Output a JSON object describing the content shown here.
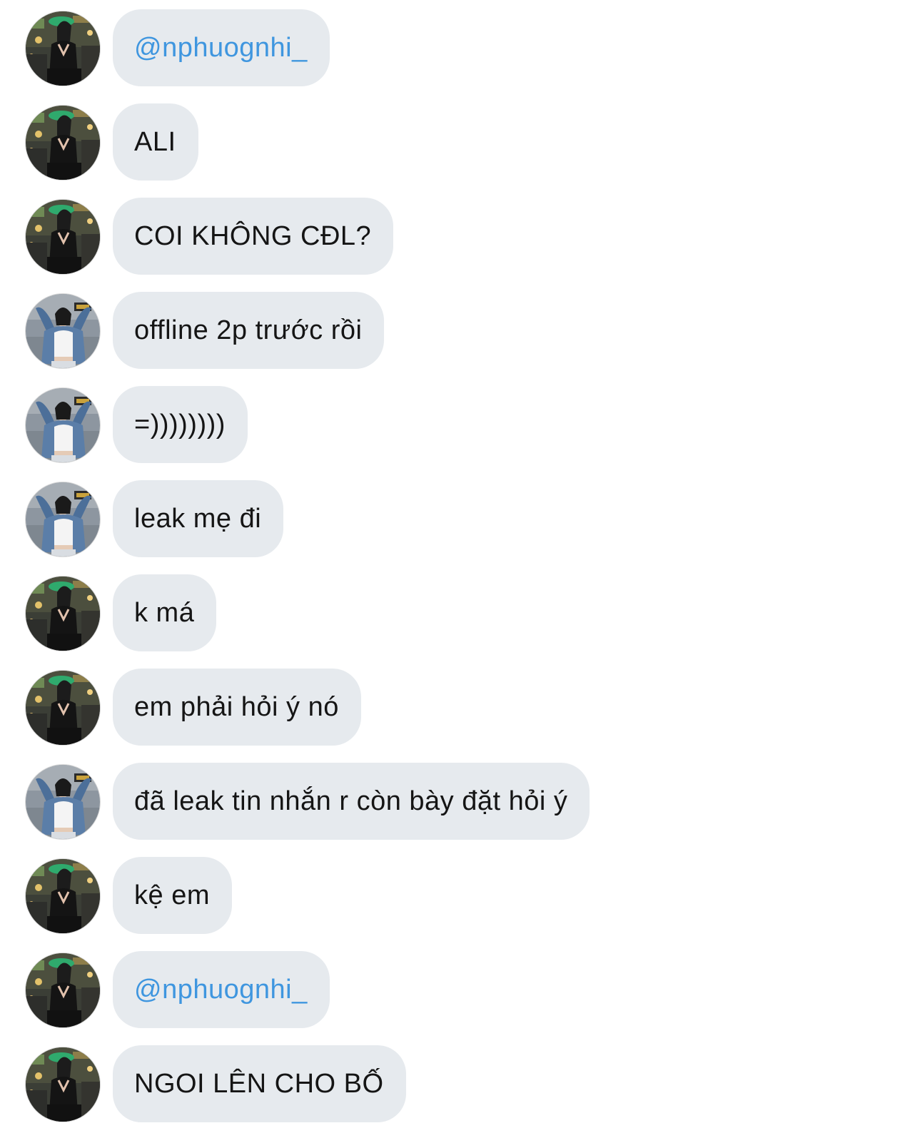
{
  "colors": {
    "bubble_background": "#e6eaee",
    "message_text": "#151515",
    "mention_text": "#3f96df",
    "page_background": "#ffffff"
  },
  "messages": [
    {
      "sender": "user_a",
      "text": "@nphuognhi_",
      "is_mention": true
    },
    {
      "sender": "user_a",
      "text": "ALI",
      "is_mention": false
    },
    {
      "sender": "user_a",
      "text": "COI KHÔNG CĐL?",
      "is_mention": false
    },
    {
      "sender": "user_b",
      "text": "offline 2p trước rồi",
      "is_mention": false
    },
    {
      "sender": "user_b",
      "text": "=))))))))",
      "is_mention": false
    },
    {
      "sender": "user_b",
      "text": "leak mẹ đi",
      "is_mention": false
    },
    {
      "sender": "user_a",
      "text": "k má",
      "is_mention": false
    },
    {
      "sender": "user_a",
      "text": "em phải hỏi ý nó",
      "is_mention": false
    },
    {
      "sender": "user_b",
      "text": "đã leak tin nhắn r còn bày đặt hỏi ý",
      "is_mention": false
    },
    {
      "sender": "user_a",
      "text": "kệ em",
      "is_mention": false
    },
    {
      "sender": "user_a",
      "text": "@nphuognhi_",
      "is_mention": true
    },
    {
      "sender": "user_a",
      "text": "NGOI LÊN CHO BỐ",
      "is_mention": false
    }
  ]
}
